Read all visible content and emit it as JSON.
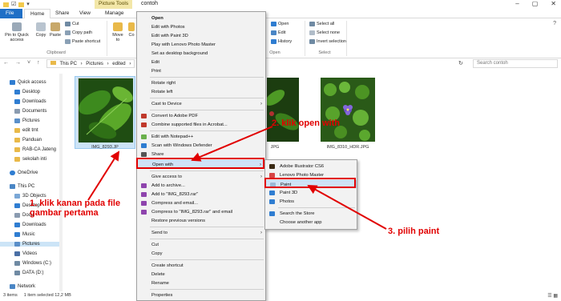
{
  "titlebar": {
    "picture_tools": "Picture Tools",
    "window_title": "contoh",
    "controls": [
      "–",
      "▢",
      "✕"
    ]
  },
  "tabs": {
    "file": "File",
    "home": "Home",
    "share": "Share",
    "view": "View",
    "manage": "Manage"
  },
  "ribbon": {
    "pin": "Pin to Quick access",
    "copy": "Copy",
    "paste": "Paste",
    "cut": "Cut",
    "copy_path": "Copy path",
    "paste_shortcut": "Paste shortcut",
    "move_to": "Move to",
    "copy_to": "Co",
    "clipboard_group": "Clipboard",
    "open": "Open",
    "edit": "Edit",
    "history": "History",
    "open_group": "Open",
    "select_all": "Select all",
    "select_none": "Select none",
    "invert_selection": "Invert selection",
    "select_group": "Select"
  },
  "address": {
    "segments": [
      "This PC",
      "›",
      "Pictures",
      "›",
      "edited",
      "›",
      "c"
    ],
    "search_placeholder": "Search contoh"
  },
  "nav": {
    "quick_access": "Quick access",
    "desktop": "Desktop",
    "downloads": "Downloads",
    "documents": "Documents",
    "pictures": "Pictures",
    "edit_tmt": "edit tmt",
    "panduan": "Panduan",
    "rab_ca": "RAB-CA Jateng",
    "sekolah_inti": "sekolah inti",
    "onedrive": "OneDrive",
    "this_pc": "This PC",
    "objects_3d": "3D Objects",
    "desktop2": "Desktop",
    "documents2": "Docu",
    "downloads2": "Downloads",
    "music": "Music",
    "pictures2": "Pictures",
    "videos": "Videos",
    "windows_c": "Windows (C:)",
    "data_d": "DATA (D:)",
    "network": "Network"
  },
  "files": {
    "file1": "IMG_8293.JP",
    "file2": "JPG",
    "file3": "IMG_8310_HDR.JPG"
  },
  "status": {
    "items": "3 items",
    "selected": "1 item selected  12,2 MB"
  },
  "context_menu": {
    "open": "Open",
    "edit_photos": "Edit with Photos",
    "edit_paint3d": "Edit with Paint 3D",
    "play_lenovo": "Play with Lenovo Photo Master",
    "set_desktop": "Set as desktop background",
    "edit": "Edit",
    "print": "Print",
    "rotate_right": "Rotate right",
    "rotate_left": "Rotate left",
    "cast": "Cast to Device",
    "convert_pdf": "Convert to Adobe PDF",
    "combine": "Combine supported files in Acrobat...",
    "notepad": "Edit with Notepad++",
    "defender": "Scan with Windows Defender",
    "share": "Share",
    "open_with": "Open with",
    "give_access": "Give access to",
    "add_archive": "Add to archive...",
    "add_rar": "Add to \"IMG_8293.rar\"",
    "compress_email": "Compress and email...",
    "compress_rar_email": "Compress to \"IMG_8293.rar\" and email",
    "restore": "Restore previous versions",
    "send_to": "Send to",
    "cut": "Cut",
    "copy": "Copy",
    "create_shortcut": "Create shortcut",
    "delete": "Delete",
    "rename": "Rename",
    "properties": "Properties"
  },
  "submenu": {
    "illustrator": "Adobe Illustrator CS6",
    "lenovo": "Lenovo Photo Master",
    "paint": "Paint",
    "paint3d": "Paint 3D",
    "photos": "Photos",
    "search_store": "Search the Store",
    "choose_app": "Choose another app"
  },
  "annotations": {
    "step1": "1. klik kanan pada file gambar pertama",
    "step2": "2. klik open with",
    "step3": "3. pilih paint"
  },
  "colors": {
    "accent": "#1f6fc6",
    "annotation": "#e10000",
    "selection": "#cce4f7"
  }
}
